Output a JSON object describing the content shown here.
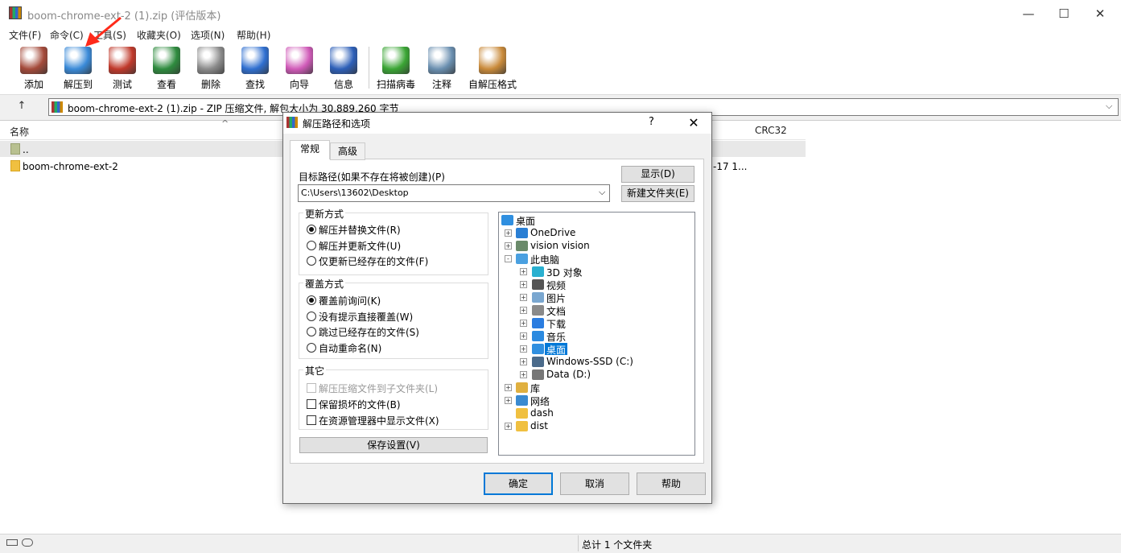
{
  "window": {
    "title": "boom-chrome-ext-2 (1).zip (评估版本)",
    "minimize": "—",
    "maximize": "☐",
    "close": "✕"
  },
  "menu": [
    "文件(F)",
    "命令(C)",
    "工具(S)",
    "收藏夹(O)",
    "选项(N)",
    "帮助(H)"
  ],
  "toolbar": [
    {
      "label": "添加",
      "icon": "books-icon",
      "color": "#a44a3a"
    },
    {
      "label": "解压到",
      "icon": "folder-extract-icon",
      "color": "#3a8ad8"
    },
    {
      "label": "测试",
      "icon": "clipboard-check-icon",
      "color": "#c0392b"
    },
    {
      "label": "查看",
      "icon": "book-icon",
      "color": "#2e8b3e"
    },
    {
      "label": "删除",
      "icon": "trash-icon",
      "color": "#8a8a8a"
    },
    {
      "label": "查找",
      "icon": "magnifier-icon",
      "color": "#2f6fd0"
    },
    {
      "label": "向导",
      "icon": "magic-wand-icon",
      "color": "#d05ab8"
    },
    {
      "label": "信息",
      "icon": "info-icon",
      "color": "#2d5fb8"
    },
    {
      "label": "扫描病毒",
      "icon": "virus-scan-icon",
      "color": "#3aa534"
    },
    {
      "label": "注释",
      "icon": "comment-icon",
      "color": "#6a8fb0"
    },
    {
      "label": "自解压格式",
      "icon": "sfx-box-icon",
      "color": "#c98a3a"
    }
  ],
  "address": {
    "text": "boom-chrome-ext-2 (1).zip - ZIP 压缩文件, 解包大小为 30,889,260 字节"
  },
  "list": {
    "col_name": "名称",
    "col_crc": "CRC32",
    "sort_arrow": "^",
    "rows": [
      {
        "name": "..",
        "modified": ""
      },
      {
        "name": "boom-chrome-ext-2",
        "modified": "-17 1..."
      }
    ]
  },
  "status": {
    "text": "总计 1 个文件夹"
  },
  "dialog": {
    "title": "解压路径和选项",
    "help": "?",
    "close": "✕",
    "tabs": [
      "常规",
      "高级"
    ],
    "path_label": "目标路径(如果不存在将被创建)(P)",
    "path_value": "C:\\Users\\13602\\Desktop",
    "show_button": "显示(D)",
    "new_folder_button": "新建文件夹(E)",
    "update_group": {
      "title": "更新方式",
      "options": [
        "解压并替换文件(R)",
        "解压并更新文件(U)",
        "仅更新已经存在的文件(F)"
      ],
      "selected": 0
    },
    "overwrite_group": {
      "title": "覆盖方式",
      "options": [
        "覆盖前询问(K)",
        "没有提示直接覆盖(W)",
        "跳过已经存在的文件(S)",
        "自动重命名(N)"
      ],
      "selected": 0
    },
    "misc_group": {
      "title": "其它",
      "options": [
        {
          "label": "解压压缩文件到子文件夹(L)",
          "checked": false,
          "disabled": true
        },
        {
          "label": "保留损坏的文件(B)",
          "checked": false,
          "disabled": false
        },
        {
          "label": "在资源管理器中显示文件(X)",
          "checked": false,
          "disabled": false
        }
      ]
    },
    "save_button": "保存设置(V)",
    "tree": [
      {
        "label": "桌面",
        "level": 0,
        "toggle": "",
        "icon": "desktop-icon"
      },
      {
        "label": "OneDrive",
        "level": 1,
        "toggle": "+",
        "icon": "cloud-icon"
      },
      {
        "label": "vision vision",
        "level": 1,
        "toggle": "+",
        "icon": "user-icon"
      },
      {
        "label": "此电脑",
        "level": 1,
        "toggle": "-",
        "icon": "computer-icon"
      },
      {
        "label": "3D 对象",
        "level": 2,
        "toggle": "+",
        "icon": "3d-objects-icon"
      },
      {
        "label": "视频",
        "level": 2,
        "toggle": "+",
        "icon": "video-icon"
      },
      {
        "label": "图片",
        "level": 2,
        "toggle": "+",
        "icon": "pictures-icon"
      },
      {
        "label": "文档",
        "level": 2,
        "toggle": "+",
        "icon": "documents-icon"
      },
      {
        "label": "下载",
        "level": 2,
        "toggle": "+",
        "icon": "download-icon"
      },
      {
        "label": "音乐",
        "level": 2,
        "toggle": "+",
        "icon": "music-icon"
      },
      {
        "label": "桌面",
        "level": 2,
        "toggle": "+",
        "icon": "desktop-icon",
        "selected": true
      },
      {
        "label": "Windows-SSD (C:)",
        "level": 2,
        "toggle": "+",
        "icon": "drive-c-icon"
      },
      {
        "label": "Data (D:)",
        "level": 2,
        "toggle": "+",
        "icon": "drive-d-icon"
      },
      {
        "label": "库",
        "level": 1,
        "toggle": "+",
        "icon": "library-icon"
      },
      {
        "label": "网络",
        "level": 1,
        "toggle": "+",
        "icon": "network-icon"
      },
      {
        "label": "dash",
        "level": 1,
        "toggle": "",
        "icon": "folder-icon"
      },
      {
        "label": "dist",
        "level": 1,
        "toggle": "+",
        "icon": "folder-icon"
      }
    ],
    "ok_button": "确定",
    "cancel_button": "取消",
    "help_button": "帮助"
  },
  "colors": {
    "accent": "#0078d7",
    "arrow": "#ff2a1a",
    "folder": "#f0c040"
  }
}
